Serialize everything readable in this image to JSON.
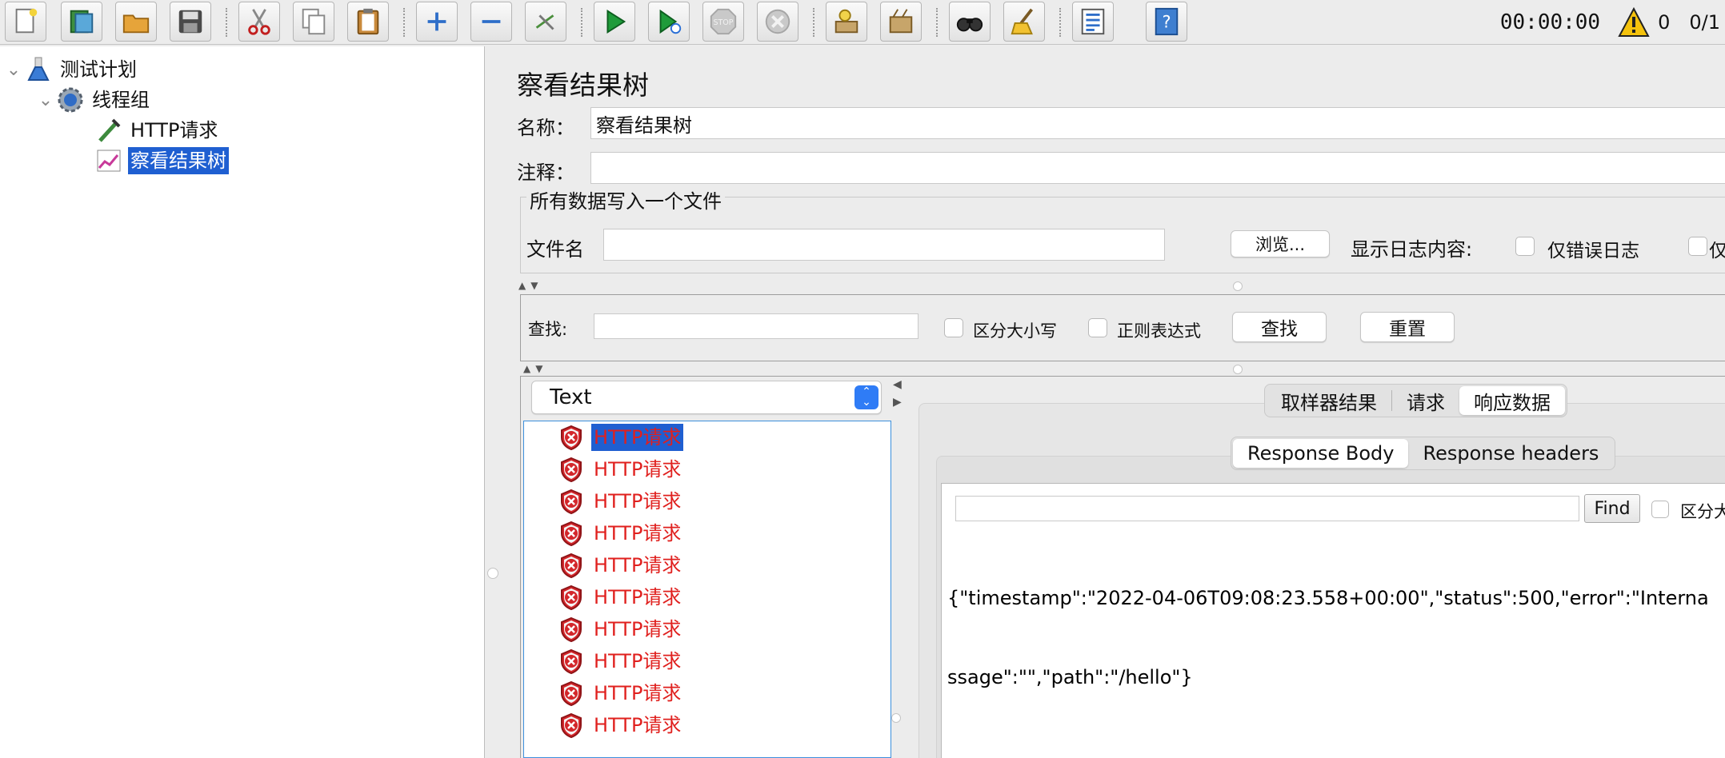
{
  "toolbar": {
    "buttons": [
      {
        "name": "new-icon"
      },
      {
        "name": "templates-icon"
      },
      {
        "name": "open-icon"
      },
      {
        "name": "save-icon"
      },
      {
        "name": "cut-icon"
      },
      {
        "name": "copy-icon"
      },
      {
        "name": "paste-icon"
      },
      {
        "name": "expand-icon"
      },
      {
        "name": "collapse-icon"
      },
      {
        "name": "toggle-icon"
      },
      {
        "name": "start-icon"
      },
      {
        "name": "start-no-pauses-icon"
      },
      {
        "name": "stop-icon"
      },
      {
        "name": "shutdown-icon"
      },
      {
        "name": "clear-icon"
      },
      {
        "name": "clear-all-icon"
      },
      {
        "name": "search-icon"
      },
      {
        "name": "reset-search-icon"
      },
      {
        "name": "function-helper-icon"
      },
      {
        "name": "help-icon"
      }
    ],
    "timer": "00:00:00",
    "warning_count": "0",
    "threads": "0/1"
  },
  "tree": {
    "items": [
      {
        "label": "测试计划",
        "icon": "test-plan-icon",
        "level": 0,
        "expanded": true
      },
      {
        "label": "线程组",
        "icon": "thread-group-icon",
        "level": 1,
        "expanded": true
      },
      {
        "label": "HTTP请求",
        "icon": "http-sampler-icon",
        "level": 2
      },
      {
        "label": "察看结果树",
        "icon": "listener-icon",
        "level": 2,
        "selected": true
      }
    ]
  },
  "panel": {
    "title": "察看结果树",
    "name_label": "名称：",
    "name_value": "察看结果树",
    "comment_label": "注释：",
    "comment_value": "",
    "file_group_title": "所有数据写入一个文件",
    "filename_label": "文件名",
    "filename_value": "",
    "browse_button": "浏览...",
    "log_content_label": "显示日志内容:",
    "errors_only_label": "仅错误日志",
    "successes_only_label": "仅"
  },
  "search": {
    "label": "查找:",
    "value": "",
    "case_sensitive_label": "区分大小写",
    "regex_label": "正则表达式",
    "find_button": "查找",
    "reset_button": "重置"
  },
  "results": {
    "renderer": "Text",
    "items": [
      {
        "label": "HTTP请求",
        "status": "error",
        "selected": true
      },
      {
        "label": "HTTP请求",
        "status": "error"
      },
      {
        "label": "HTTP请求",
        "status": "error"
      },
      {
        "label": "HTTP请求",
        "status": "error"
      },
      {
        "label": "HTTP请求",
        "status": "error"
      },
      {
        "label": "HTTP请求",
        "status": "error"
      },
      {
        "label": "HTTP请求",
        "status": "error"
      },
      {
        "label": "HTTP请求",
        "status": "error"
      },
      {
        "label": "HTTP请求",
        "status": "error"
      },
      {
        "label": "HTTP请求",
        "status": "error"
      }
    ]
  },
  "detail": {
    "tabs": [
      {
        "label": "取样器结果"
      },
      {
        "label": "请求"
      },
      {
        "label": "响应数据",
        "active": true
      }
    ],
    "subtabs": [
      {
        "label": "Response Body",
        "active": true
      },
      {
        "label": "Response headers"
      }
    ],
    "find_value": "",
    "find_button": "Find",
    "find_case_label": "区分大",
    "response_body_line1": "{\"timestamp\":\"2022-04-06T09:08:23.558+00:00\",\"status\":500,\"error\":\"Interna",
    "response_body_line2": "ssage\":\"\",\"path\":\"/hello\"}"
  },
  "colors": {
    "selection": "#1f5fd1",
    "error_text": "#e0201e",
    "list_border": "#3c8fdc",
    "toggle_blue": "#2f7cf6"
  }
}
